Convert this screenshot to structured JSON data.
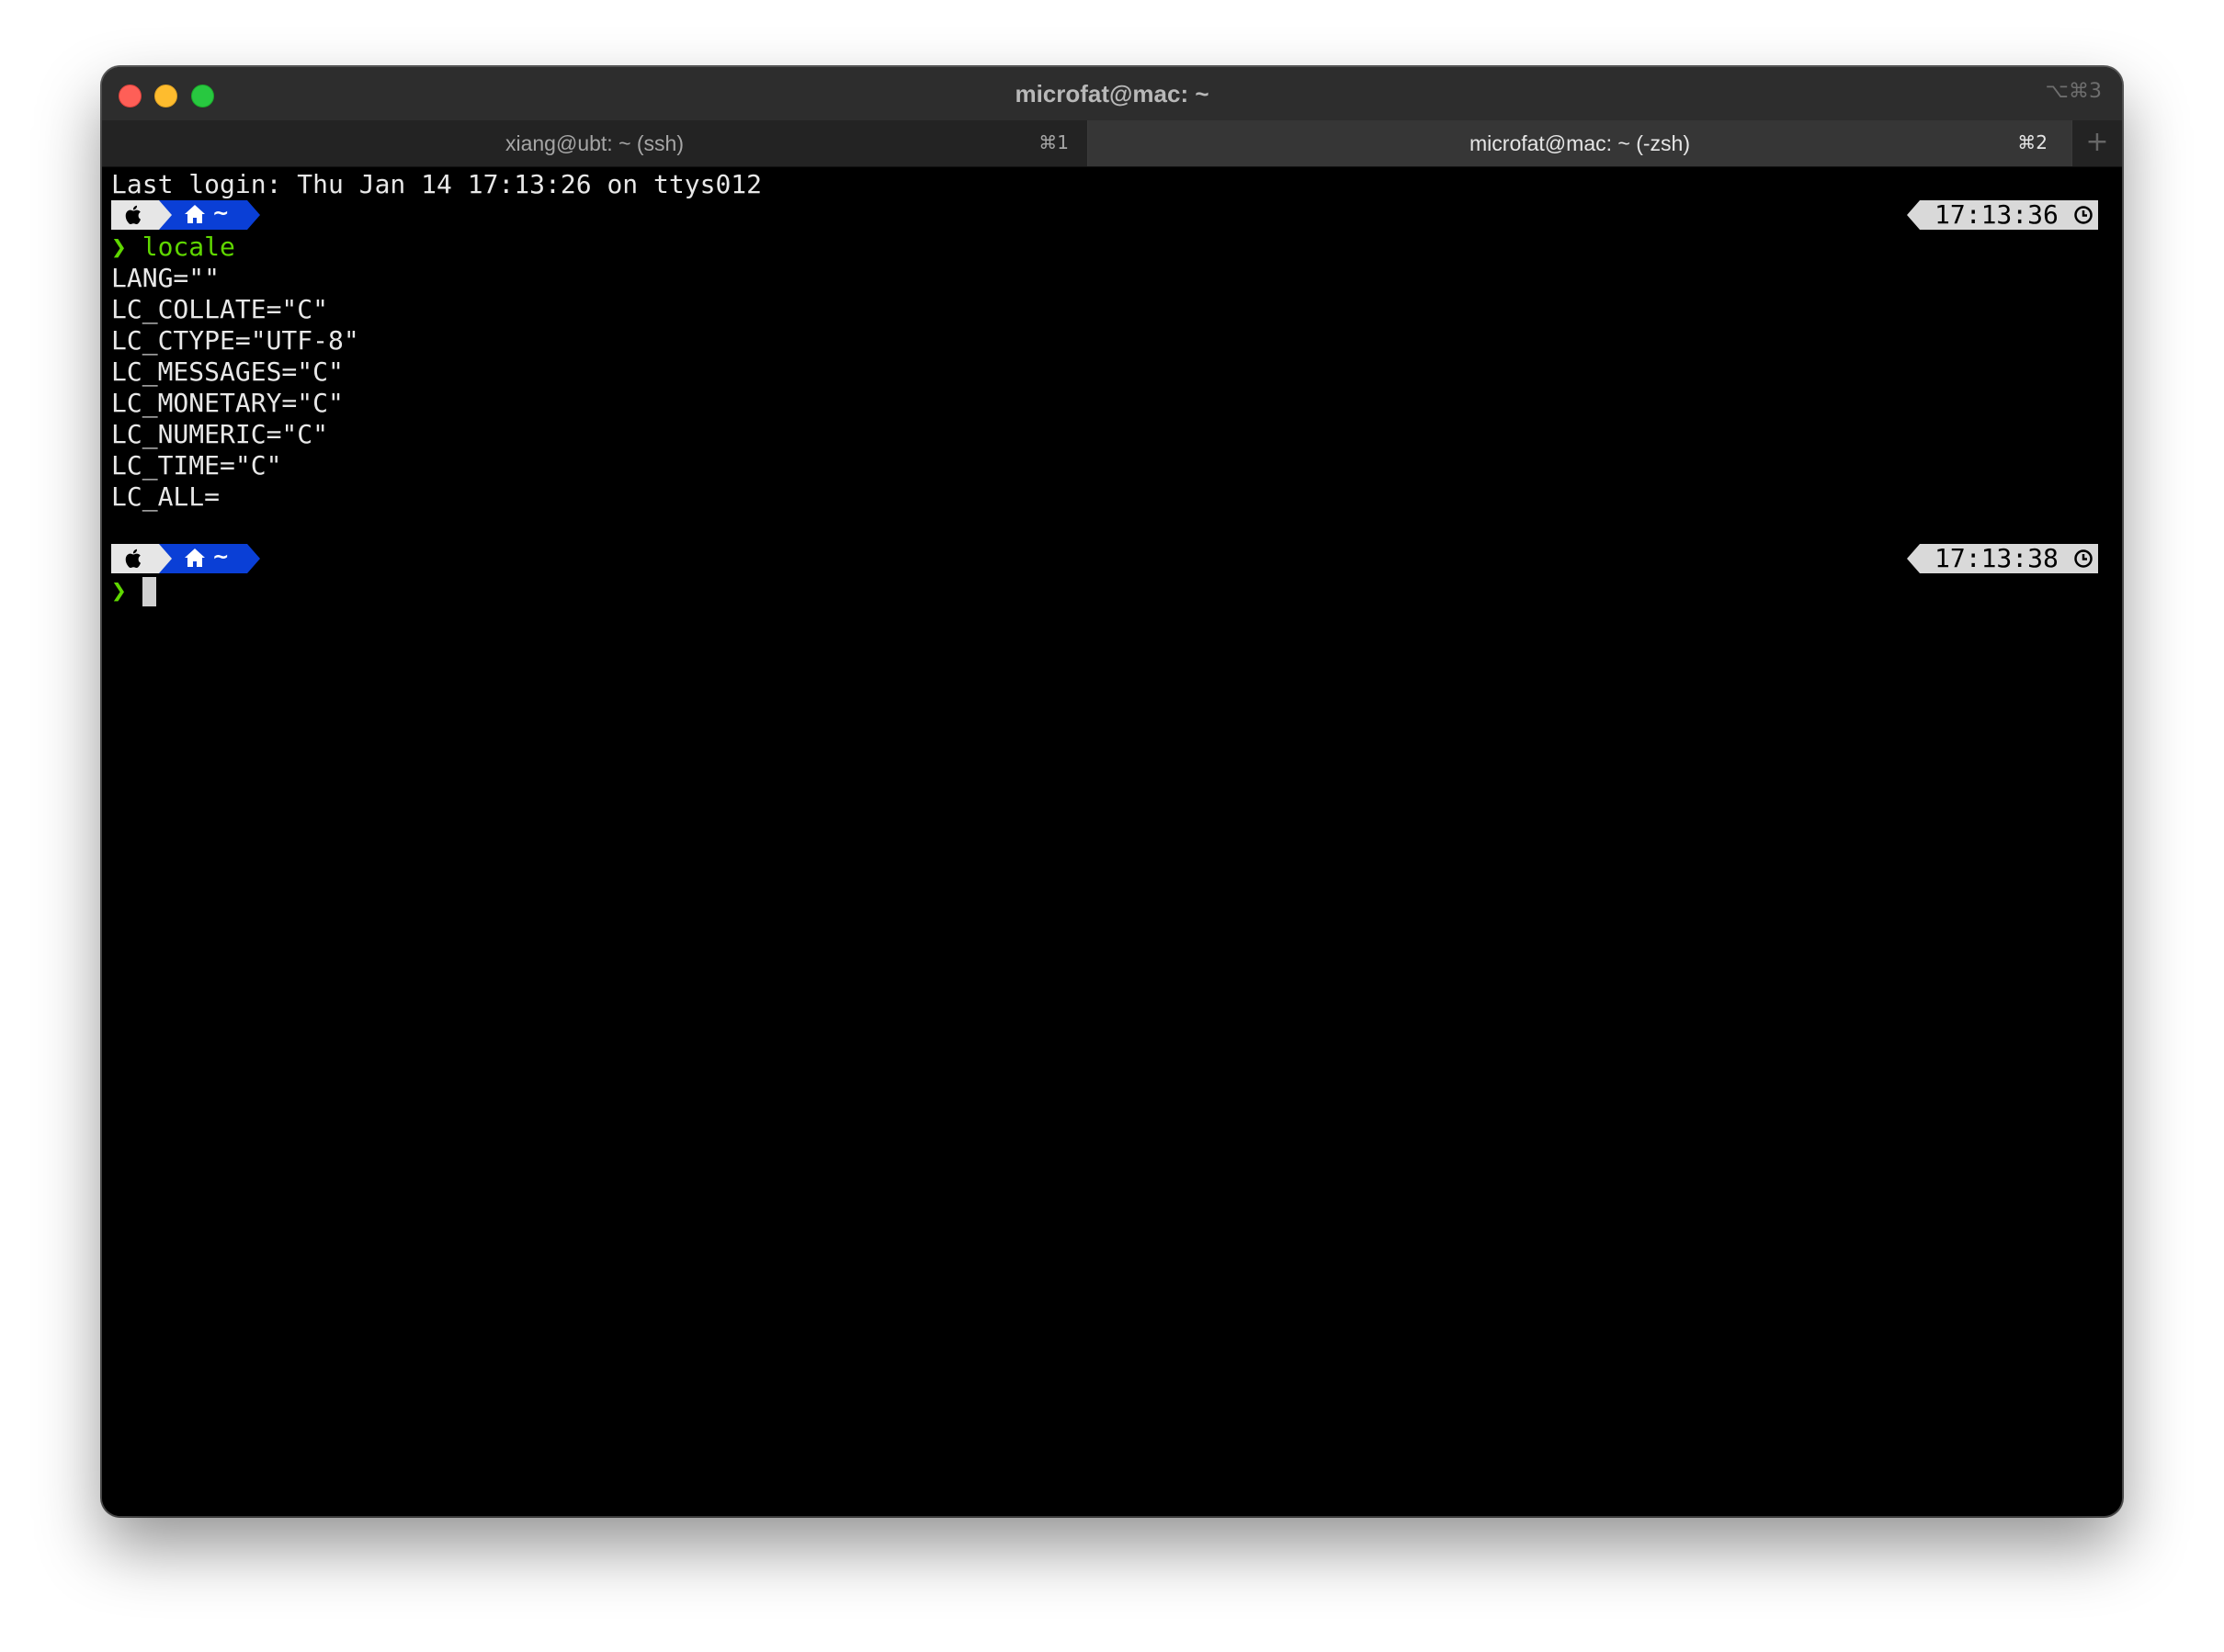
{
  "window": {
    "title": "microfat@mac: ~",
    "shortcut": "⌥⌘3"
  },
  "tabs": [
    {
      "label": "xiang@ubt: ~ (ssh)",
      "shortcut": "⌘1",
      "active": false
    },
    {
      "label": "microfat@mac: ~ (-zsh)",
      "shortcut": "⌘2",
      "active": true
    }
  ],
  "new_tab_icon": "plus-icon",
  "terminal": {
    "last_login": "Last login: Thu Jan 14 17:13:26 on ttys012",
    "prompt_segments": {
      "os_icon": "apple-icon",
      "home_icon": "home-icon",
      "dir": "~"
    },
    "prompt_char": "❯",
    "prompts": [
      {
        "time": "17:13:36",
        "command": "locale"
      },
      {
        "time": "17:13:38",
        "command": ""
      }
    ],
    "output": [
      "LANG=\"\"",
      "LC_COLLATE=\"C\"",
      "LC_CTYPE=\"UTF-8\"",
      "LC_MESSAGES=\"C\"",
      "LC_MONETARY=\"C\"",
      "LC_NUMERIC=\"C\"",
      "LC_TIME=\"C\"",
      "LC_ALL="
    ]
  },
  "colors": {
    "terminal_bg": "#000000",
    "dir_segment": "#0a3fd6",
    "prompt_green": "#5fd700",
    "time_segment": "#d9d9d9"
  }
}
